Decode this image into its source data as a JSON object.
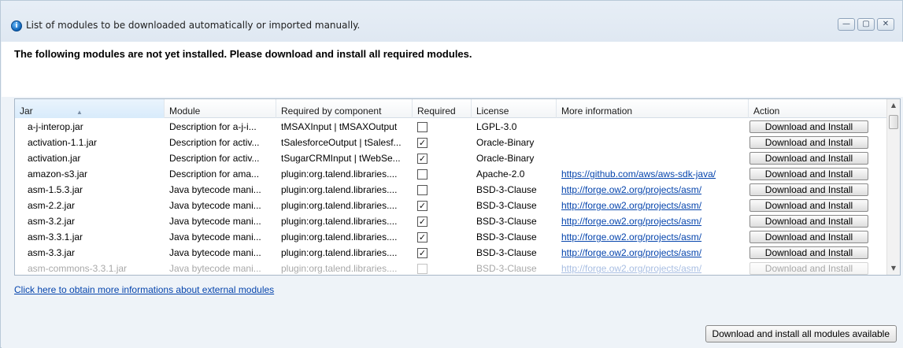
{
  "window": {
    "title": "List of modules to be downloaded automatically or imported manually."
  },
  "banner": "The following modules are not yet installed. Please download and install all required modules.",
  "table": {
    "columns": [
      "Jar",
      "Module",
      "Required by component",
      "Required",
      "License",
      "More information",
      "Action"
    ],
    "rows": [
      {
        "jar": "a-j-interop.jar",
        "module": "Description for a-j-i...",
        "component": "tMSAXInput | tMSAXOutput",
        "required": false,
        "license": "LGPL-3.0",
        "info": "",
        "action": "Download and Install"
      },
      {
        "jar": "activation-1.1.jar",
        "module": "Description for activ...",
        "component": "tSalesforceOutput | tSalesf...",
        "required": true,
        "license": "Oracle-Binary",
        "info": "",
        "action": "Download and Install"
      },
      {
        "jar": "activation.jar",
        "module": "Description for activ...",
        "component": "tSugarCRMInput | tWebSe...",
        "required": true,
        "license": "Oracle-Binary",
        "info": "",
        "action": "Download and Install"
      },
      {
        "jar": "amazon-s3.jar",
        "module": "Description for ama...",
        "component": "plugin:org.talend.libraries....",
        "required": false,
        "license": "Apache-2.0",
        "info": "https://github.com/aws/aws-sdk-java/",
        "action": "Download and Install"
      },
      {
        "jar": "asm-1.5.3.jar",
        "module": "Java bytecode mani...",
        "component": "plugin:org.talend.libraries....",
        "required": false,
        "license": "BSD-3-Clause",
        "info": "http://forge.ow2.org/projects/asm/",
        "action": "Download and Install"
      },
      {
        "jar": "asm-2.2.jar",
        "module": "Java bytecode mani...",
        "component": "plugin:org.talend.libraries....",
        "required": true,
        "license": "BSD-3-Clause",
        "info": "http://forge.ow2.org/projects/asm/",
        "action": "Download and Install"
      },
      {
        "jar": "asm-3.2.jar",
        "module": "Java bytecode mani...",
        "component": "plugin:org.talend.libraries....",
        "required": true,
        "license": "BSD-3-Clause",
        "info": "http://forge.ow2.org/projects/asm/",
        "action": "Download and Install"
      },
      {
        "jar": "asm-3.3.1.jar",
        "module": "Java bytecode mani...",
        "component": "plugin:org.talend.libraries....",
        "required": true,
        "license": "BSD-3-Clause",
        "info": "http://forge.ow2.org/projects/asm/",
        "action": "Download and Install"
      },
      {
        "jar": "asm-3.3.jar",
        "module": "Java bytecode mani...",
        "component": "plugin:org.talend.libraries....",
        "required": true,
        "license": "BSD-3-Clause",
        "info": "http://forge.ow2.org/projects/asm/",
        "action": "Download and Install"
      },
      {
        "jar": "asm-commons-3.3.1.jar",
        "module": "Java bytecode mani...",
        "component": "plugin:org.talend.libraries....",
        "required": false,
        "license": "BSD-3-Clause",
        "info": "http://forge.ow2.org/projects/asm/",
        "action": "Download and Install"
      }
    ]
  },
  "footer": {
    "link": "Click here to obtain more informations about external modules",
    "install_all": "Download and install all modules available"
  },
  "icons": {
    "app": "info-icon",
    "minimize": "minimize-icon",
    "maximize": "maximize-icon",
    "close": "close-icon",
    "checked": "✓"
  }
}
